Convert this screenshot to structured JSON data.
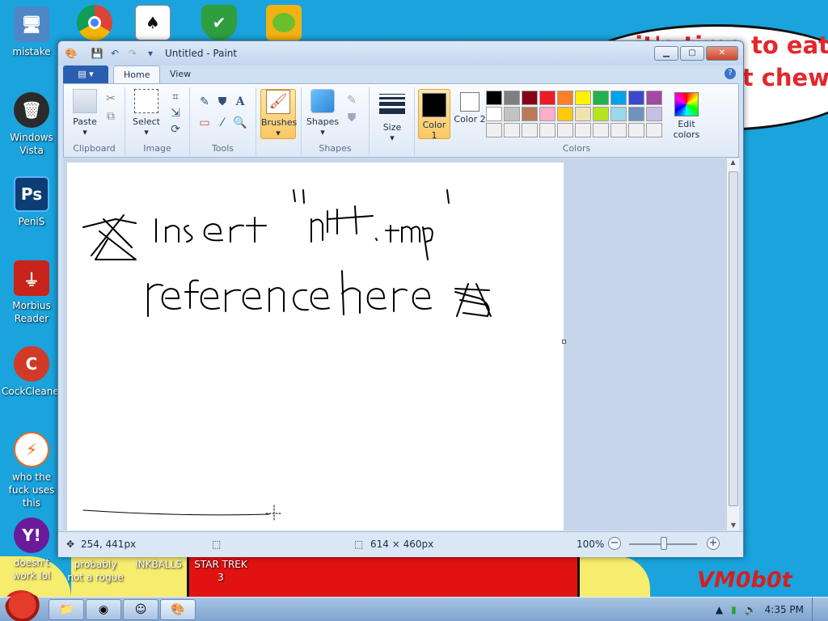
{
  "desktop": {
    "bubble_text": "it's time to eat shit chew",
    "watermark": "VM0b0t",
    "icons": [
      {
        "label": "mistake",
        "icon": "computer-icon",
        "color": "#4f86c6"
      },
      {
        "label": "Windows Vista",
        "icon": "trash-icon",
        "color": "#2b2b2b"
      },
      {
        "label": "PeniS",
        "icon": "photoshop-icon",
        "color": "#0c3d74"
      },
      {
        "label": "Morbius Reader",
        "icon": "pdf-icon",
        "color": "#c8241b"
      },
      {
        "label": "CockCleaner",
        "icon": "ccleaner-icon",
        "color": "#d23a28"
      },
      {
        "label": "who the fuck uses this",
        "icon": "bolt-icon",
        "color": "#ef6a1a"
      },
      {
        "label": "doesn't work lol",
        "icon": "yahoo-icon",
        "color": "#6a1b9a"
      }
    ],
    "top_icons": [
      {
        "icon": "chrome-icon"
      },
      {
        "icon": "solitaire-icon"
      },
      {
        "icon": "shield-icon"
      },
      {
        "icon": "pig-icon"
      }
    ],
    "bottom_labels": [
      "probably not a rogue",
      "INKBALLS",
      "STAR TREK 3"
    ]
  },
  "paint": {
    "title": "Untitled - Paint",
    "tabs": [
      "Home",
      "View"
    ],
    "active_tab": "Home",
    "groups": {
      "clipboard": {
        "label": "Clipboard",
        "paste": "Paste"
      },
      "image": {
        "label": "Image",
        "select": "Select"
      },
      "tools": {
        "label": "Tools"
      },
      "brushes": {
        "label": "Brushes"
      },
      "shapes": {
        "label": "Shapes",
        "shapes_btn": "Shapes"
      },
      "size": {
        "label": "Size"
      },
      "colors": {
        "label": "Colors",
        "color1": "Color 1",
        "color2": "Color 2",
        "edit_colors": "Edit colors",
        "color1_value": "#000000",
        "color2_value": "#ffffff",
        "palette": [
          "#000000",
          "#7f7f7f",
          "#880015",
          "#ed1c24",
          "#ff7f27",
          "#fff200",
          "#22b14c",
          "#00a2e8",
          "#3f48cc",
          "#a349a4",
          "#ffffff",
          "#c3c3c3",
          "#b97a57",
          "#ffaec9",
          "#ffc90e",
          "#efe4b0",
          "#b5e61d",
          "#99d9ea",
          "#7092be",
          "#c8bfe7",
          "#f0f0f0",
          "#f0f0f0",
          "#f0f0f0",
          "#f0f0f0",
          "#f0f0f0",
          "#f0f0f0",
          "#f0f0f0",
          "#f0f0f0",
          "#f0f0f0",
          "#f0f0f0"
        ]
      }
    },
    "canvas_text": {
      "line1": "insert \"n''t.tmp\"",
      "line2": "reference here"
    },
    "status": {
      "cursor_pos": "254, 441px",
      "canvas_size": "614 × 460px",
      "zoom": "100%"
    }
  },
  "taskbar": {
    "time": "4:35 PM",
    "apps": [
      "explorer-icon",
      "chrome-icon",
      "messenger-icon",
      "paint-icon"
    ]
  }
}
